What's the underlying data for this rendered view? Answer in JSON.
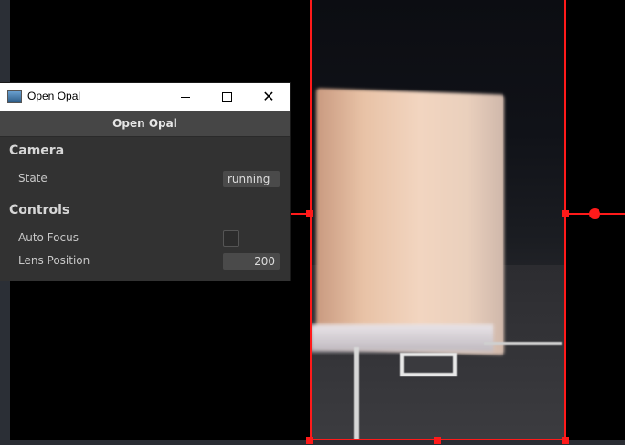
{
  "window": {
    "title": "Open Opal",
    "header": "Open Opal"
  },
  "camera": {
    "section_label": "Camera",
    "state_label": "State",
    "state_value": "running"
  },
  "controls": {
    "section_label": "Controls",
    "auto_focus_label": "Auto Focus",
    "auto_focus_checked": false,
    "lens_position_label": "Lens Position",
    "lens_position_value": "200"
  },
  "colors": {
    "roi": "#ff1a1a",
    "panel_bg": "#323232"
  },
  "icons": {
    "app": "app-icon",
    "minimize": "minimize-icon",
    "maximize": "maximize-icon",
    "close": "close-icon"
  }
}
